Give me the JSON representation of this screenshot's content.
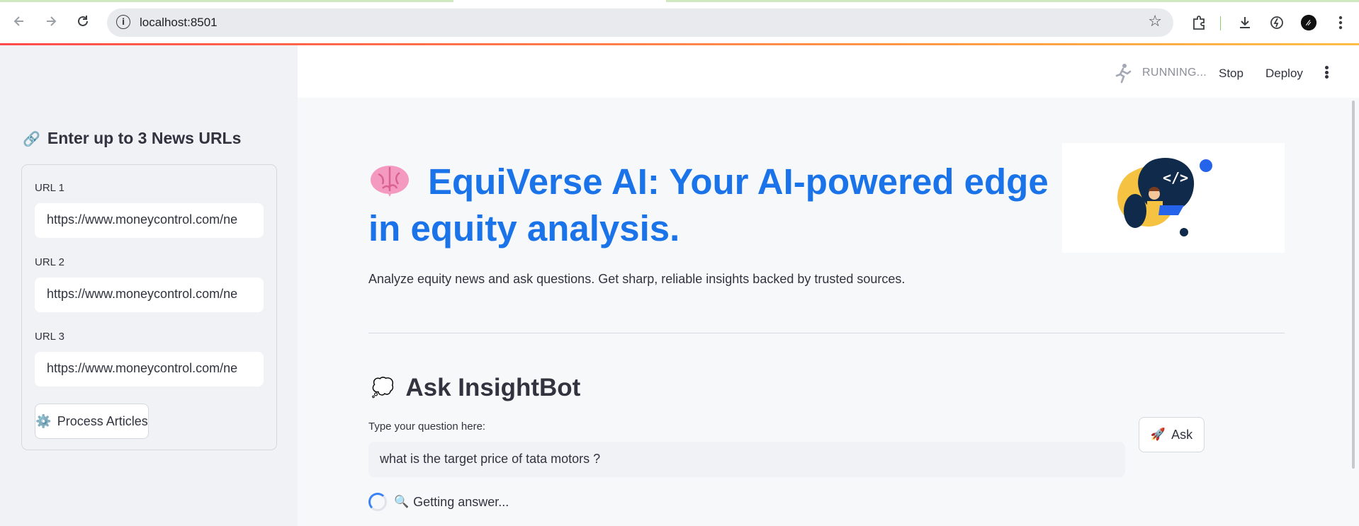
{
  "browser": {
    "url": "localhost:8501",
    "icons": [
      "back-arrow-icon",
      "forward-arrow-icon",
      "reload-icon",
      "site-info-icon",
      "bookmark-star-icon",
      "extensions-icon",
      "download-icon",
      "performance-icon",
      "profile-avatar-icon",
      "chrome-menu-icon"
    ]
  },
  "app_header": {
    "status_text": "RUNNING...",
    "stop_label": "Stop",
    "deploy_label": "Deploy"
  },
  "sidebar": {
    "header_icon": "🔗",
    "header_text": "Enter up to 3 News URLs",
    "inputs": [
      {
        "label": "URL 1",
        "value": "https://www.moneycontrol.com/ne"
      },
      {
        "label": "URL 2",
        "value": "https://www.moneycontrol.com/ne"
      },
      {
        "label": "URL 3",
        "value": "https://www.moneycontrol.com/ne"
      }
    ],
    "process_icon": "⚙️",
    "process_label": "Process Articles"
  },
  "main": {
    "title_emoji": "🧠",
    "title_text": "EquiVerse AI: Your AI-powered edge in equity analysis.",
    "subtitle": "Analyze equity news and ask questions. Get sharp, reliable insights backed by trusted sources.",
    "ask_icon": "💭",
    "ask_heading": "Ask InsightBot",
    "question_label": "Type your question here:",
    "question_value": "what is the target price of tata motors ?",
    "ask_button_icon": "🚀",
    "ask_button_label": "Ask",
    "loading_icon": "🔍",
    "loading_text": "Getting answer...",
    "logo_glyph": "</>"
  },
  "colors": {
    "accent_blue": "#1a73e8",
    "sidebar_bg": "#f0f2f6",
    "text": "#31333f"
  }
}
